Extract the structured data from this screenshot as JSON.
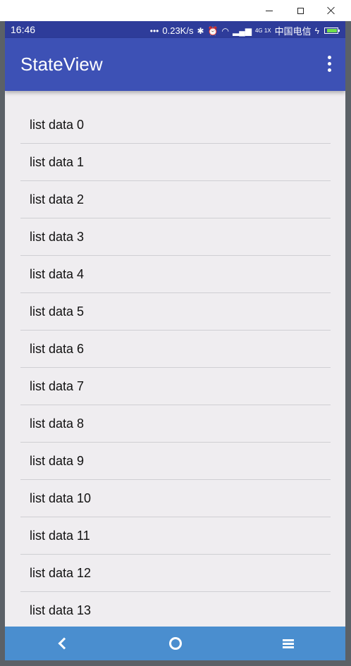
{
  "window": {
    "controls": [
      "minimize",
      "maximize",
      "close"
    ]
  },
  "status_bar": {
    "time": "16:46",
    "network_speed": "0.23K/s",
    "signal_label": "4G 1X",
    "carrier": "中国电信",
    "icons": [
      "dots-icon",
      "bluetooth-icon",
      "alarm-icon",
      "wifi-icon",
      "signal-icon",
      "charging-icon",
      "battery-icon"
    ]
  },
  "app_bar": {
    "title": "StateView"
  },
  "list": {
    "items": [
      "list data 0",
      "list data 1",
      "list data 2",
      "list data 3",
      "list data 4",
      "list data 5",
      "list data 6",
      "list data 7",
      "list data 8",
      "list data 9",
      "list data 10",
      "list data 11",
      "list data 12",
      "list data 13"
    ]
  },
  "nav_bar": {
    "buttons": [
      "back",
      "home",
      "menu"
    ]
  },
  "colors": {
    "status_bar": "#2e3c9a",
    "app_bar": "#3d51b5",
    "nav_bar": "#4a8ecf",
    "list_bg": "#efedf0"
  }
}
